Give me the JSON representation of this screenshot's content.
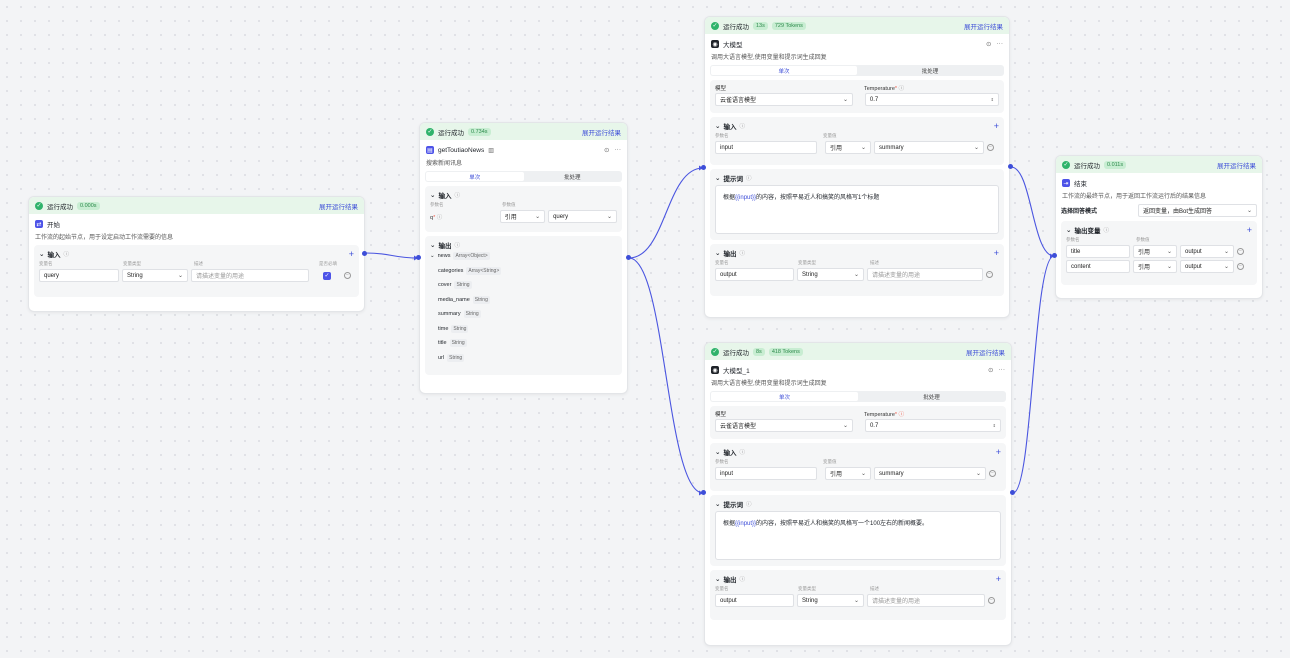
{
  "canvas": {
    "accent": "#3d4ed8",
    "edge_color": "#4a55e0",
    "success_bg": "#e7f6ea"
  },
  "start": {
    "status": "运行成功",
    "time": "0.000s",
    "expand": "展开运行结果",
    "title": "开始",
    "icon": "start-icon",
    "desc": "工作流的起始节点，用于设定启动工作流需要的信息",
    "input_title": "输入",
    "cols": [
      "变量名",
      "变量类型",
      "描述",
      "是否必填"
    ],
    "row": {
      "name": "query",
      "type": "String",
      "desc_placeholder": "请描述变量的用途"
    }
  },
  "news": {
    "status": "运行成功",
    "time": "0.734s",
    "expand": "展开运行结果",
    "title": "getToutiaoNews",
    "desc": "搜索新闻讯息",
    "tabs": [
      "单次",
      "批处理"
    ],
    "input_title": "输入",
    "cols": [
      "参数名",
      "参数值"
    ],
    "param": {
      "name": "q",
      "mode": "引用",
      "value": "query"
    },
    "output_title": "输出",
    "root": {
      "name": "news",
      "type": "Array<Object>"
    },
    "fields": [
      {
        "name": "categories",
        "type": "Array<String>"
      },
      {
        "name": "cover",
        "type": "String"
      },
      {
        "name": "media_name",
        "type": "String"
      },
      {
        "name": "summary",
        "type": "String"
      },
      {
        "name": "time",
        "type": "String"
      },
      {
        "name": "title",
        "type": "String"
      },
      {
        "name": "url",
        "type": "String"
      }
    ]
  },
  "llm1": {
    "status": "运行成功",
    "time": "13s",
    "tokens": "729 Tokens",
    "expand": "展开运行结果",
    "title": "大模型",
    "desc": "调用大语言模型,使用变量和提示词生成回复",
    "tabs": [
      "单次",
      "批处理"
    ],
    "model_label": "模型",
    "model": "云雀语言模型",
    "temp_label": "Temperature",
    "temp": "0.7",
    "input_title": "输入",
    "cols": [
      "参数名",
      "变量值"
    ],
    "input": {
      "name": "input",
      "mode": "引用",
      "value": "summary"
    },
    "prompt_title": "提示词",
    "prompt_pre": "根据",
    "prompt_var": "{{input}}",
    "prompt_post": "的内容，按照平易近人和搞笑的风格写1个标题",
    "output_title": "输出",
    "out_cols": [
      "变量名",
      "变量类型",
      "描述"
    ],
    "output": {
      "name": "output",
      "type": "String",
      "desc_placeholder": "请描述变量的用途"
    }
  },
  "llm2": {
    "status": "运行成功",
    "time": "8s",
    "tokens": "418 Tokens",
    "expand": "展开运行结果",
    "title": "大模型_1",
    "desc": "调用大语言模型,使用变量和提示词生成回复",
    "tabs": [
      "单次",
      "批处理"
    ],
    "model_label": "模型",
    "model": "云雀语言模型",
    "temp_label": "Temperature",
    "temp": "0.7",
    "input_title": "输入",
    "cols": [
      "参数名",
      "变量值"
    ],
    "input": {
      "name": "input",
      "mode": "引用",
      "value": "summary"
    },
    "prompt_title": "提示词",
    "prompt_pre": "根据",
    "prompt_var": "{{input}}",
    "prompt_post": "的内容，按照平易近人和搞笑的风格写一个100左右的新闻概要。",
    "output_title": "输出",
    "out_cols": [
      "变量名",
      "变量类型",
      "描述"
    ],
    "output": {
      "name": "output",
      "type": "String",
      "desc_placeholder": "请描述变量的用途"
    }
  },
  "end": {
    "status": "运行成功",
    "time": "0.011s",
    "expand": "展开运行结果",
    "title": "结束",
    "desc": "工作流的最终节点，用于返回工作流运行后的结果信息",
    "mode_label": "选择回答模式",
    "mode": "返回变量，由Bot生成回答",
    "vars_title": "输出变量",
    "cols": [
      "参数名",
      "参数值"
    ],
    "rows": [
      {
        "name": "title",
        "mode": "引用",
        "value": "output"
      },
      {
        "name": "content",
        "mode": "引用",
        "value": "output"
      }
    ]
  }
}
